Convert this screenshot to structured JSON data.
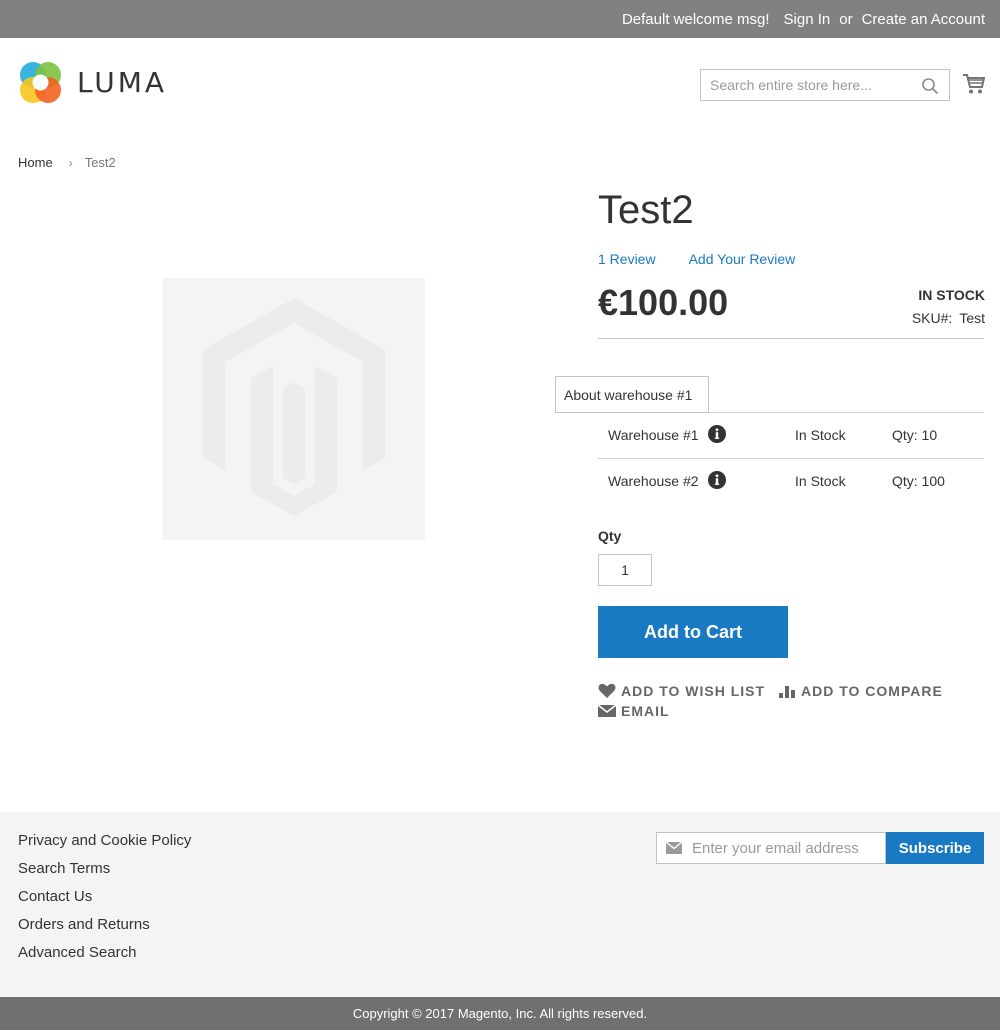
{
  "header_panel": {
    "welcome": "Default welcome msg!",
    "sign_in": "Sign In",
    "or": "or",
    "create_account": "Create an Account"
  },
  "logo": {
    "text": "LUMA",
    "icon": "luma-logo-icon"
  },
  "search": {
    "placeholder": "Search entire store here...",
    "value": "",
    "icon": "search-icon"
  },
  "cart": {
    "icon": "cart-icon"
  },
  "breadcrumb": {
    "items": [
      "Home",
      "Test2"
    ],
    "separator": "›"
  },
  "product": {
    "title": "Test2",
    "review_count": "1 Review",
    "add_review": "Add Your Review",
    "price": "€100.00",
    "stock": "IN STOCK",
    "sku_label": "SKU#:",
    "sku_value": "Test",
    "placeholder_image": "magento-placeholder-icon"
  },
  "tooltip": {
    "text": "About warehouse #1"
  },
  "warehouses": [
    {
      "name": "Warehouse #1",
      "status": "In Stock",
      "qty": "Qty: 10",
      "icon": "info-icon"
    },
    {
      "name": "Warehouse #2",
      "status": "In Stock",
      "qty": "Qty: 100",
      "icon": "info-icon"
    }
  ],
  "qty": {
    "label": "Qty",
    "value": "1"
  },
  "add_to_cart": "Add to Cart",
  "actions": {
    "wishlist": "ADD TO WISH LIST",
    "compare": "ADD TO COMPARE",
    "email": "EMAIL"
  },
  "footer": {
    "links": [
      "Privacy and Cookie Policy",
      "Search Terms",
      "Contact Us",
      "Orders and Returns",
      "Advanced Search"
    ],
    "newsletter_placeholder": "Enter your email address",
    "subscribe": "Subscribe",
    "copyright": "Copyright © 2017 Magento, Inc. All rights reserved."
  },
  "colors": {
    "accent": "#1979c3",
    "top_bar": "#818181",
    "copyright_bar": "#6e716e",
    "footer_bg": "#f4f4f4"
  }
}
